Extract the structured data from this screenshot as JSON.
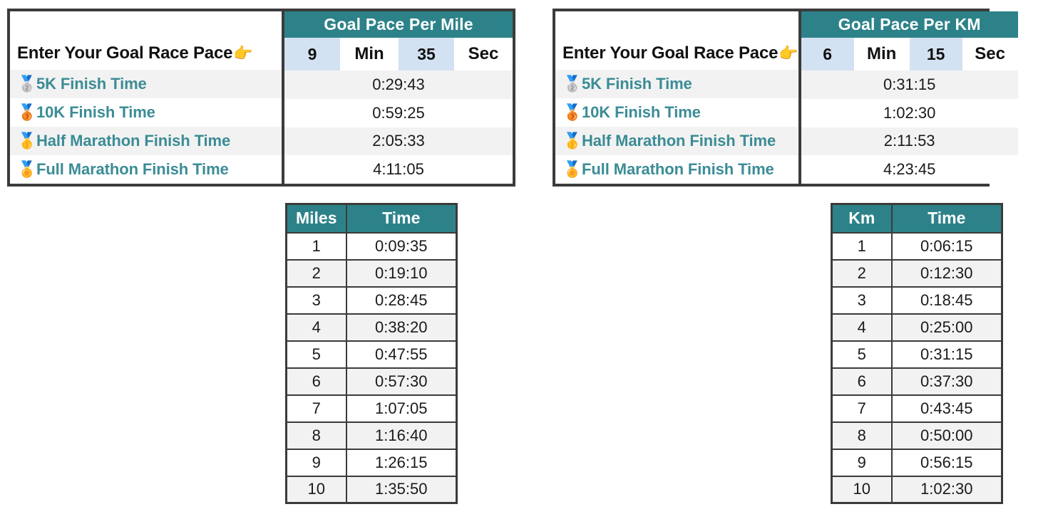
{
  "panels": [
    {
      "id": "mile",
      "title": "Goal Pace Per Mile",
      "prompt": "Enter Your Goal Race Pace",
      "hand_icon": "👉",
      "pace": {
        "minutes": "9",
        "minutes_unit": "Min",
        "seconds": "35",
        "seconds_unit": "Sec"
      },
      "rows": [
        {
          "medal": "🥈",
          "label": "5K Finish Time",
          "value": "0:29:43"
        },
        {
          "medal": "🥉",
          "label": "10K Finish Time",
          "value": "0:59:25"
        },
        {
          "medal": "🥇",
          "label": "Half Marathon Finish Time",
          "value": "2:05:33"
        },
        {
          "medal": "🏅",
          "label": "Full Marathon Finish Time",
          "value": "4:11:05"
        }
      ]
    },
    {
      "id": "km",
      "title": "Goal Pace Per KM",
      "prompt": "Enter Your Goal Race Pace",
      "hand_icon": "👉",
      "pace": {
        "minutes": "6",
        "minutes_unit": "Min",
        "seconds": "15",
        "seconds_unit": "Sec"
      },
      "rows": [
        {
          "medal": "🥈",
          "label": "5K Finish Time",
          "value": "0:31:15"
        },
        {
          "medal": "🥉",
          "label": "10K Finish Time",
          "value": "1:02:30"
        },
        {
          "medal": "🥇",
          "label": "Half Marathon Finish Time",
          "value": "2:11:53"
        },
        {
          "medal": "🏅",
          "label": "Full Marathon Finish Time",
          "value": "4:23:45"
        }
      ]
    }
  ],
  "split_tables": [
    {
      "id": "miles",
      "headers": [
        "Miles",
        "Time"
      ],
      "rows": [
        [
          "1",
          "0:09:35"
        ],
        [
          "2",
          "0:19:10"
        ],
        [
          "3",
          "0:28:45"
        ],
        [
          "4",
          "0:38:20"
        ],
        [
          "5",
          "0:47:55"
        ],
        [
          "6",
          "0:57:30"
        ],
        [
          "7",
          "1:07:05"
        ],
        [
          "8",
          "1:16:40"
        ],
        [
          "9",
          "1:26:15"
        ],
        [
          "10",
          "1:35:50"
        ]
      ]
    },
    {
      "id": "km",
      "headers": [
        "Km",
        "Time"
      ],
      "rows": [
        [
          "1",
          "0:06:15"
        ],
        [
          "2",
          "0:12:30"
        ],
        [
          "3",
          "0:18:45"
        ],
        [
          "4",
          "0:25:00"
        ],
        [
          "5",
          "0:31:15"
        ],
        [
          "6",
          "0:37:30"
        ],
        [
          "7",
          "0:43:45"
        ],
        [
          "8",
          "0:50:00"
        ],
        [
          "9",
          "0:56:15"
        ],
        [
          "10",
          "1:02:30"
        ]
      ]
    }
  ],
  "colors": {
    "header_teal": "#2d8289",
    "label_teal": "#3b8c96",
    "input_blue": "#d3e2f2",
    "row_alt_gray": "#f2f2f2",
    "border_dark": "#3b3b3b"
  }
}
